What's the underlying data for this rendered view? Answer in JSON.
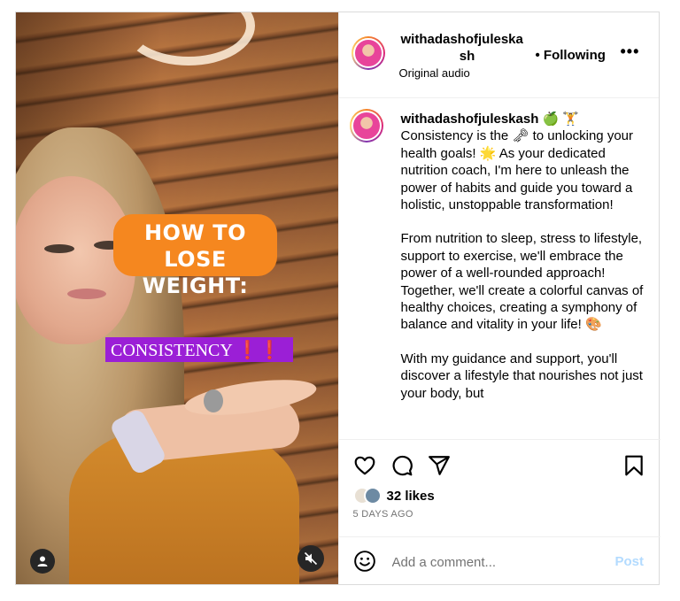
{
  "post": {
    "username_line1": "withadashofjuleska",
    "username_line2": "sh",
    "audio": "Original audio",
    "follow_status": "• Following",
    "more": "•••"
  },
  "media": {
    "overlay_line1": "HOW TO LOSE",
    "overlay_line2": "WEIGHT:",
    "overlay_caption": "CONSISTENCY",
    "overlay_caption_emphasis": "❗❗"
  },
  "caption": {
    "username": "withadashofjuleskash",
    "username_emojis": "🍏 🏋",
    "paragraphs": [
      "Consistency is the 🗝 to unlocking your health goals! 🌟 As your dedicated nutrition coach, I'm here to unleash the power of habits and guide you toward a holistic, unstoppable transformation!",
      "From nutrition to sleep, stress to lifestyle, support to exercise, we'll embrace the power of a well-rounded approach! Together, we'll create a colorful canvas of healthy choices, creating a symphony of balance and vitality in your life! 🎨",
      "With my guidance and support, you'll discover a lifestyle that nourishes not just your body, but"
    ]
  },
  "engagement": {
    "likes": "32 likes",
    "date": "5 DAYS AGO"
  },
  "comment_box": {
    "placeholder": "Add a comment...",
    "post_label": "Post"
  },
  "icons": {
    "like": "heart-icon",
    "comment": "comment-bubble-icon",
    "share": "paper-plane-icon",
    "save": "bookmark-icon",
    "emoji": "smiley-icon",
    "tagged_user": "user-icon",
    "mute": "speaker-muted-icon"
  },
  "colors": {
    "orange_sticker": "#f5871f",
    "purple_sticker": "#9b1fd6",
    "post_button_disabled": "#b3dbff",
    "secondary_text": "#737373"
  }
}
